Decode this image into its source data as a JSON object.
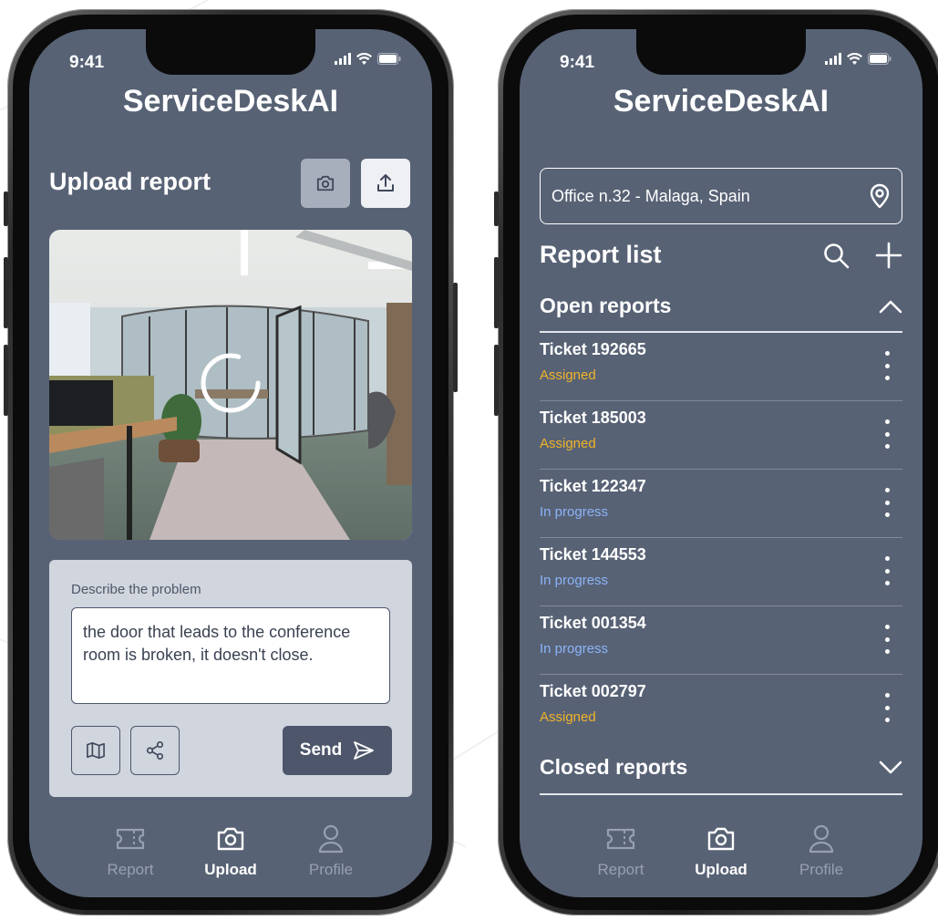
{
  "colors": {
    "screen_bg": "#586275",
    "status_assigned": "#f0b429",
    "status_in_progress": "#8ab4f8",
    "card_bg": "#d1d5de",
    "button_dark": "#4d566a"
  },
  "status_bar": {
    "time": "9:41"
  },
  "app": {
    "title": "ServiceDeskAI"
  },
  "upload_screen": {
    "section_title": "Upload report",
    "camera_button_icon": "camera-icon",
    "upload_button_icon": "upload-icon",
    "photo_alt": "Office with glass conference room",
    "form": {
      "label": "Describe the problem",
      "description": "the door that leads to the conference room is broken, it doesn't close.",
      "map_button_icon": "map-icon",
      "share_button_icon": "share-icon",
      "send_label": "Send"
    }
  },
  "list_screen": {
    "location": "Office n.32 - Malaga, Spain",
    "section_title": "Report list",
    "open_reports_label": "Open reports",
    "closed_reports_label": "Closed reports",
    "tickets": [
      {
        "title": "Ticket 192665",
        "status": "Assigned"
      },
      {
        "title": "Ticket 185003",
        "status": "Assigned"
      },
      {
        "title": "Ticket 122347",
        "status": "In progress"
      },
      {
        "title": "Ticket 144553",
        "status": "In progress"
      },
      {
        "title": "Ticket 001354",
        "status": "In progress"
      },
      {
        "title": "Ticket 002797",
        "status": "Assigned"
      }
    ]
  },
  "tabbar": {
    "tabs": [
      {
        "label": "Report",
        "icon": "ticket-icon",
        "active": false
      },
      {
        "label": "Upload",
        "icon": "camera-icon",
        "active": true
      },
      {
        "label": "Profile",
        "icon": "user-icon",
        "active": false
      }
    ]
  }
}
